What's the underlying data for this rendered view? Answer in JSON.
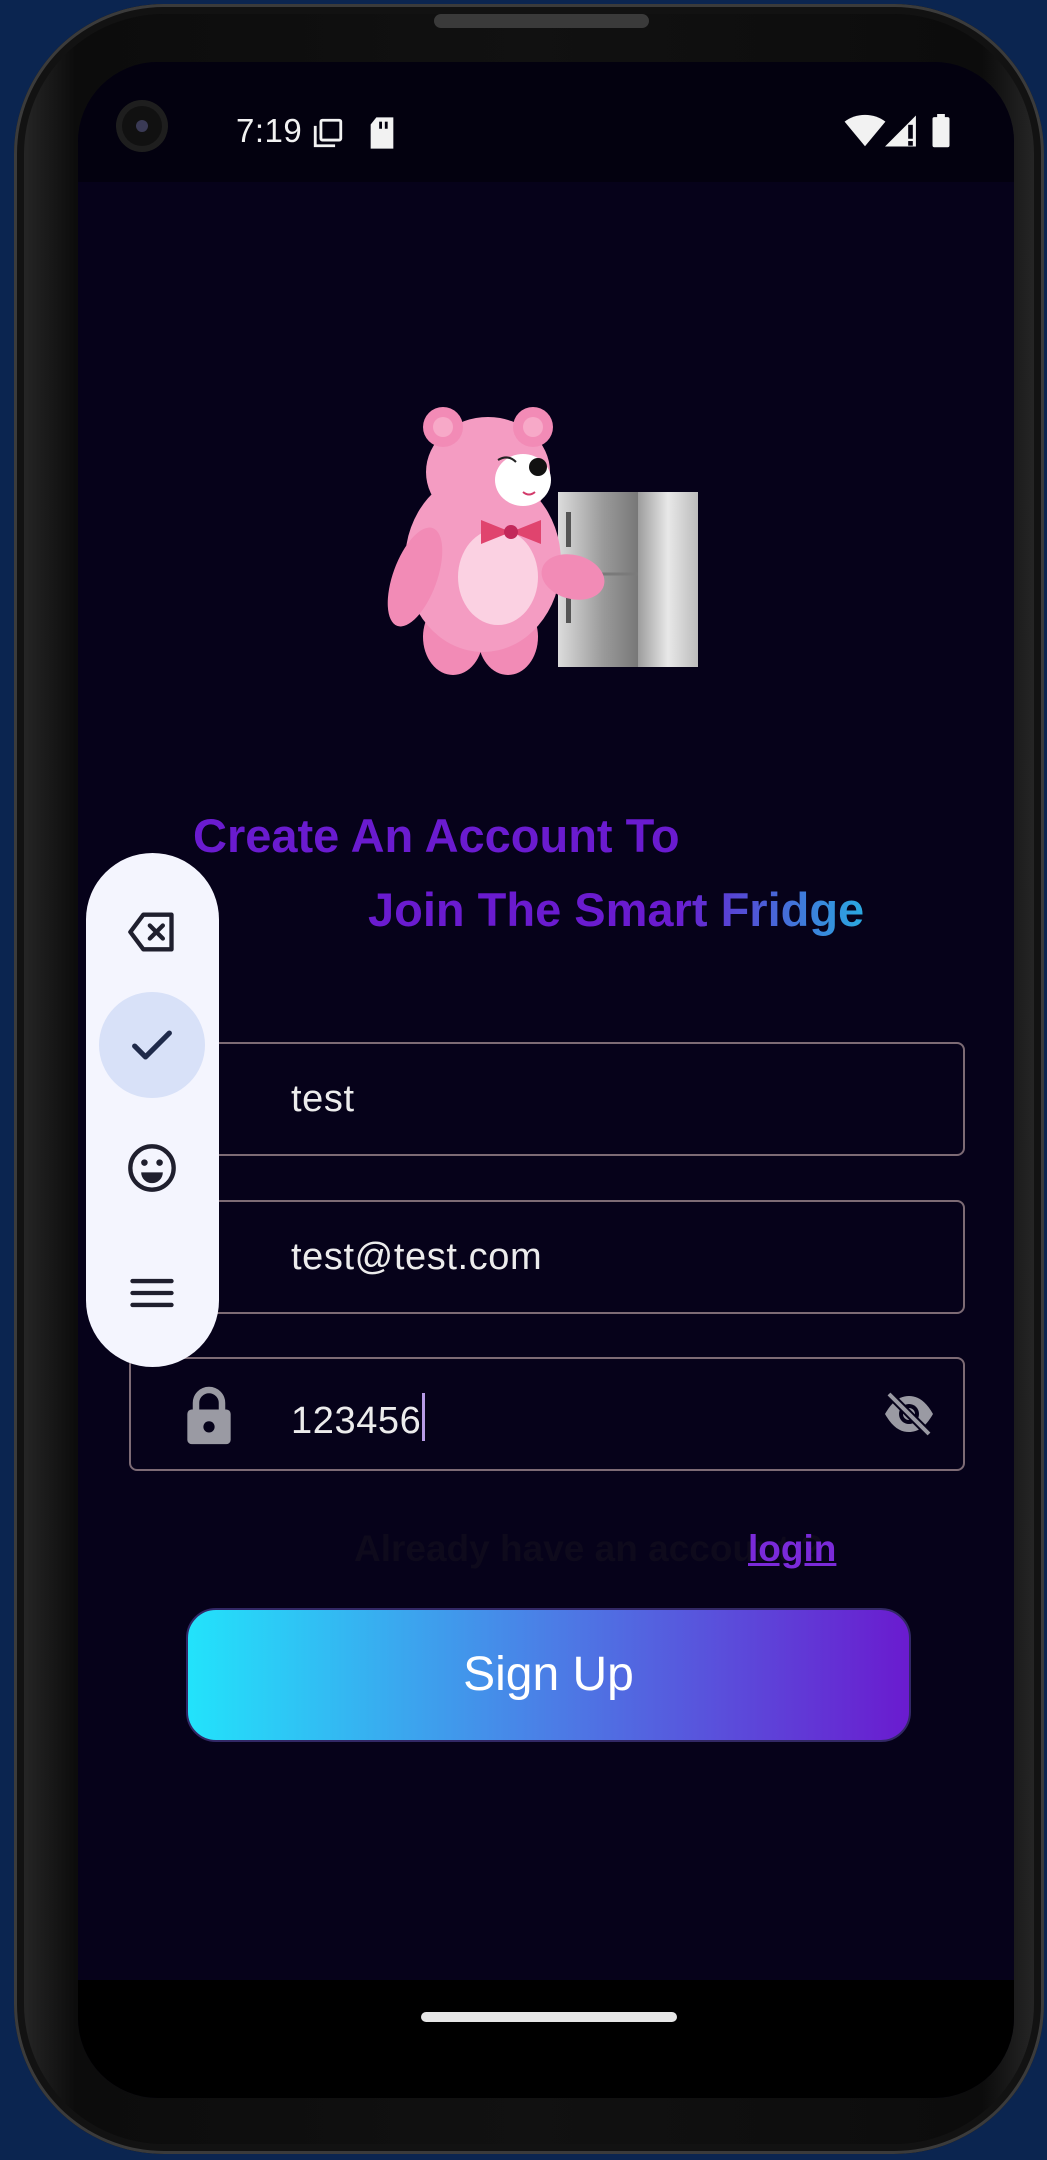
{
  "status_bar": {
    "time": "7:19",
    "left_icons": [
      "screenshot-icon",
      "sd-card-icon"
    ],
    "right_icons": [
      "wifi-icon",
      "cellular-signal-icon",
      "battery-icon"
    ]
  },
  "header": {
    "illustration": "pink-teddy-bear-with-fridge",
    "title_line1": "Create An Account To",
    "title_line2": "Join The Smart Fridge"
  },
  "form": {
    "name_value": "test",
    "email_value": "test@test.com",
    "password_value": "123456",
    "password_icon": "lock-icon",
    "visibility_icon": "visibility-off-icon"
  },
  "login_prompt": {
    "text": "Already have an account ?",
    "link": "login"
  },
  "signup_button": {
    "label": "Sign Up"
  },
  "floating_toolbar": {
    "buttons": [
      "backspace-icon",
      "check-icon",
      "emoji-icon",
      "menu-icon"
    ]
  },
  "colors": {
    "background": "#06021a",
    "accent_purple": "#6a1bcf",
    "accent_cyan": "#22e3fb",
    "link": "#7a2ad9"
  }
}
